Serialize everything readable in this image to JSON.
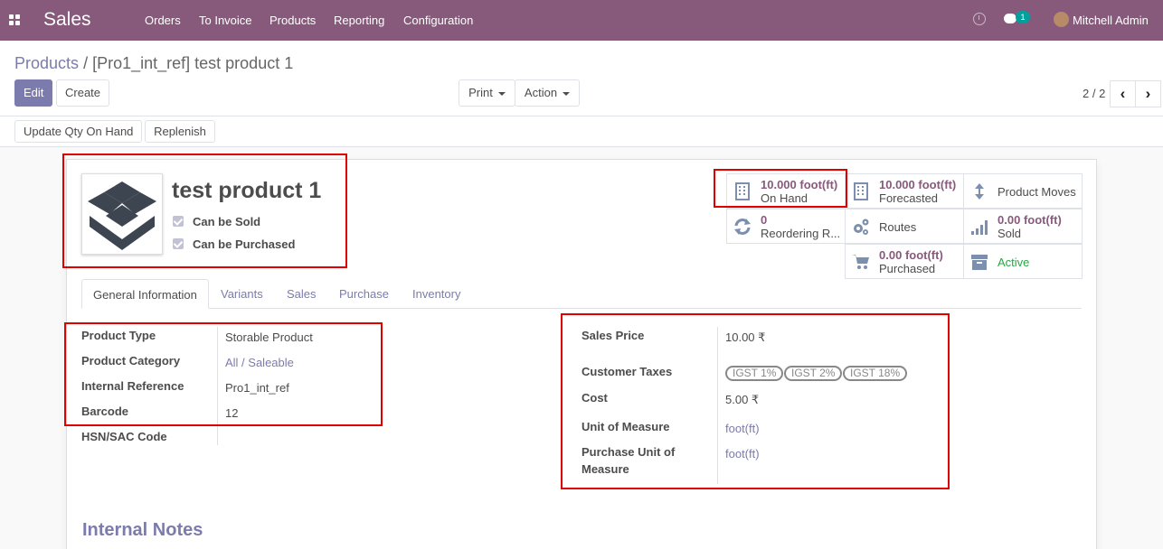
{
  "navbar": {
    "app_name": "Sales",
    "menus": [
      "Orders",
      "To Invoice",
      "Products",
      "Reporting",
      "Configuration"
    ],
    "chat_badge": "1",
    "user_name": "Mitchell Admin"
  },
  "breadcrumb": {
    "parent": "Products",
    "separator": "/",
    "current": "[Pro1_int_ref] test product 1"
  },
  "toolbar": {
    "edit": "Edit",
    "create": "Create",
    "print": "Print",
    "action": "Action",
    "pager": "2 / 2"
  },
  "header_buttons": {
    "update_qty": "Update Qty On Hand",
    "replenish": "Replenish"
  },
  "product": {
    "name": "test product 1",
    "can_be_sold": "Can be Sold",
    "can_be_purchased": "Can be Purchased"
  },
  "smart_buttons": {
    "on_hand": {
      "value": "10.000",
      "unit": "foot(ft)",
      "label": "On Hand"
    },
    "forecasted": {
      "value": "10.000",
      "unit": "foot(ft)",
      "label": "Forecasted"
    },
    "product_moves": {
      "label": "Product Moves"
    },
    "reordering": {
      "value": "0",
      "label": "Reordering R..."
    },
    "routes": {
      "label": "Routes"
    },
    "sold": {
      "value": "0.00",
      "unit": "foot(ft)",
      "label": "Sold"
    },
    "purchased": {
      "value": "0.00",
      "unit": "foot(ft)",
      "label": "Purchased"
    },
    "active": {
      "label": "Active"
    }
  },
  "tabs": [
    "General Information",
    "Variants",
    "Sales",
    "Purchase",
    "Inventory"
  ],
  "general": {
    "product_type_label": "Product Type",
    "product_type": "Storable Product",
    "category_label": "Product Category",
    "category": "All / Saleable",
    "internal_ref_label": "Internal Reference",
    "internal_ref": "Pro1_int_ref",
    "barcode_label": "Barcode",
    "barcode": "12",
    "hsn_label": "HSN/SAC Code"
  },
  "pricing": {
    "sales_price_label": "Sales Price",
    "sales_price": "10.00 ₹",
    "customer_taxes_label": "Customer Taxes",
    "taxes": [
      "IGST 1%",
      "IGST 2%",
      "IGST 18%"
    ],
    "cost_label": "Cost",
    "cost": "5.00 ₹",
    "uom_label": "Unit of Measure",
    "uom": "foot(ft)",
    "purchase_uom_label_1": "Purchase Unit of",
    "purchase_uom_label_2": "Measure",
    "purchase_uom": "foot(ft)"
  },
  "internal_notes": "Internal Notes",
  "colors": {
    "brand": "#875a7b",
    "accent": "#7c7bad",
    "active_green": "#28a745",
    "highlight_red": "#e00000"
  }
}
